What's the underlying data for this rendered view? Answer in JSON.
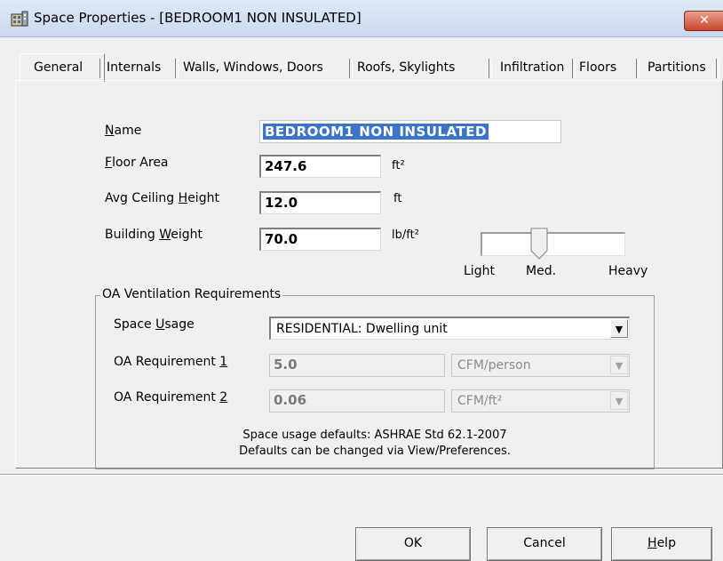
{
  "window": {
    "title": "Space Properties - [BEDROOM1 NON INSULATED]",
    "close_label": "✕"
  },
  "tabs": [
    {
      "label": "General",
      "active": true
    },
    {
      "label": "Internals"
    },
    {
      "label": "Walls, Windows, Doors"
    },
    {
      "label": "Roofs, Skylights"
    },
    {
      "label": "Infiltration"
    },
    {
      "label": "Floors"
    },
    {
      "label": "Partitions"
    }
  ],
  "general": {
    "name_label_pre": "",
    "name_label_accel": "N",
    "name_label_post": "ame",
    "name_value": "BEDROOM1 NON INSULATED",
    "floor_area_label_accel": "F",
    "floor_area_label_post": "loor Area",
    "floor_area_value": "247.6",
    "floor_area_unit": "ft²",
    "ceiling_label_pre": "Avg Ceiling ",
    "ceiling_label_accel": "H",
    "ceiling_label_post": "eight",
    "ceiling_value": "12.0",
    "ceiling_unit": "ft",
    "weight_label_pre": "Building ",
    "weight_label_accel": "W",
    "weight_label_post": "eight",
    "weight_value": "70.0",
    "weight_unit": "lb/ft²",
    "slider": {
      "labels": [
        "Light",
        "Med.",
        "Heavy"
      ],
      "level": "Med."
    }
  },
  "oa": {
    "group_title": "OA Ventilation Requirements",
    "usage_label_pre": "Space ",
    "usage_label_accel": "U",
    "usage_label_post": "sage",
    "usage_value": "RESIDENTIAL: Dwelling unit",
    "req1_label_pre": "OA Requirement ",
    "req1_label_accel": "1",
    "req1_value": "5.0",
    "req1_unit": "CFM/person",
    "req2_label_pre": "OA Requirement ",
    "req2_label_accel": "2",
    "req2_value": "0.06",
    "req2_unit": "CFM/ft²",
    "footnote_line1": "Space usage defaults: ASHRAE Std 62.1-2007",
    "footnote_line2": "Defaults can be changed via View/Preferences."
  },
  "buttons": {
    "ok": "OK",
    "cancel": "Cancel",
    "help_accel": "H",
    "help_post": "elp"
  },
  "icons": {
    "dropdown": "▼",
    "window_icon": "building-icon"
  }
}
